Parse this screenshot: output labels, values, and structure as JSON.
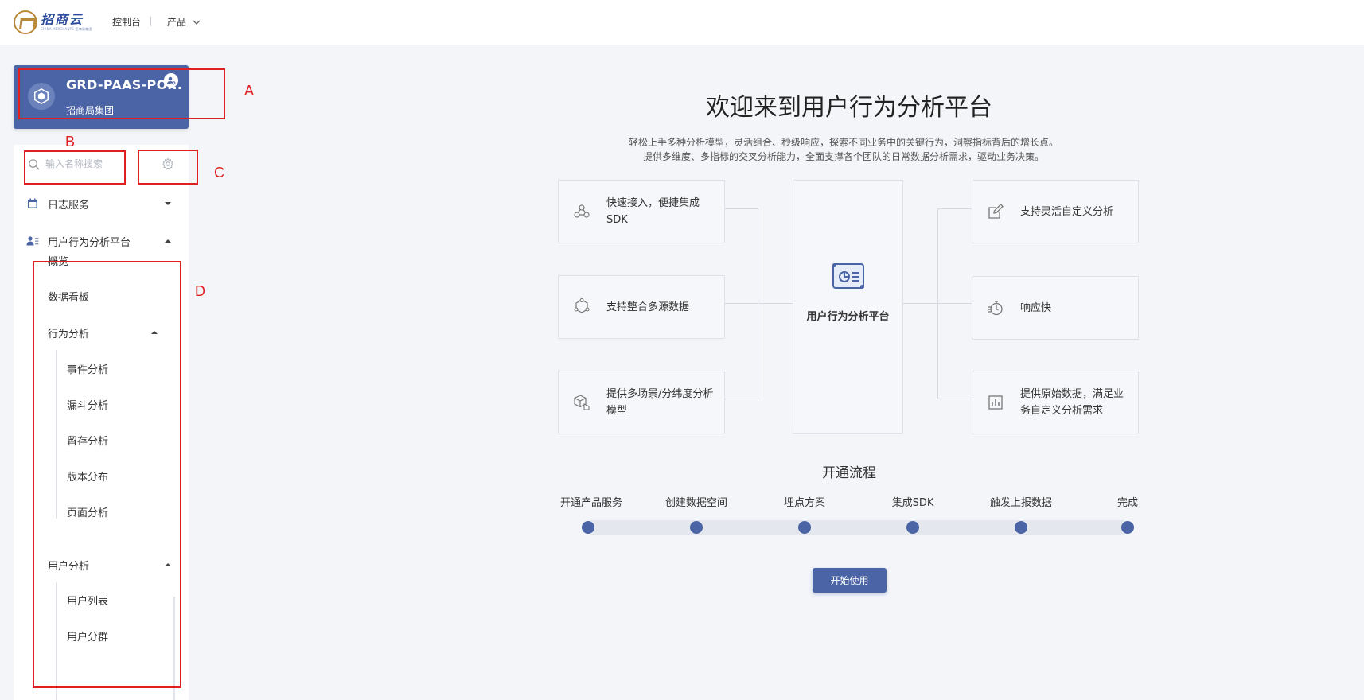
{
  "header": {
    "logo_text": "招商云",
    "logo_subtext": "CHINA MERCHANTS 招商局集团",
    "console_label": "控制台",
    "products_label": "产品"
  },
  "project": {
    "name": "GRD-PAAS-PO...",
    "org": "招商局集团"
  },
  "sidebar": {
    "search_placeholder": "输入名称搜索",
    "menu": [
      {
        "label": "日志服务",
        "icon": "calendar-icon",
        "expanded": false
      },
      {
        "label": "用户行为分析平台",
        "icon": "user-list-icon",
        "expanded": true
      }
    ],
    "platform_items": [
      {
        "label": "概览"
      },
      {
        "label": "数据看板"
      },
      {
        "label": "行为分析",
        "expanded": true
      },
      {
        "label": "用户分析",
        "expanded": true
      }
    ],
    "behavior_children": [
      "事件分析",
      "漏斗分析",
      "留存分析",
      "版本分布",
      "页面分析"
    ],
    "user_children": [
      "用户列表",
      "用户分群"
    ]
  },
  "annotations": [
    "A",
    "B",
    "C",
    "D"
  ],
  "main": {
    "title": "欢迎来到用户行为分析平台",
    "desc_line1": "轻松上手多种分析模型，灵活组合、秒级响应，探索不同业务中的关键行为，洞察指标背后的增长点。",
    "desc_line2": "提供多维度、多指标的交叉分析能力，全面支撑各个团队的日常数据分析需求，驱动业务决策。",
    "features_left": [
      {
        "text": "快速接入，便捷集成SDK",
        "icon": "sdk-icon"
      },
      {
        "text": "支持整合多源数据",
        "icon": "multi-source-icon"
      },
      {
        "text": "提供多场景/分纬度分析模型",
        "icon": "cube-model-icon"
      }
    ],
    "center_label": "用户行为分析平台",
    "features_right": [
      {
        "text": "支持灵活自定义分析",
        "icon": "edit-icon"
      },
      {
        "text": "响应快",
        "icon": "stopwatch-icon"
      },
      {
        "text": "提供原始数据，满足业务自定义分析需求",
        "icon": "bar-chart-icon"
      }
    ],
    "flow_title": "开通流程",
    "steps": [
      "开通产品服务",
      "创建数据空间",
      "埋点方案",
      "集成SDK",
      "触发上报数据",
      "完成"
    ],
    "start_button": "开始使用"
  },
  "colors": {
    "primary": "#4a64a6",
    "annotation_red": "#e02020",
    "page_bg": "#f3f5f9"
  }
}
